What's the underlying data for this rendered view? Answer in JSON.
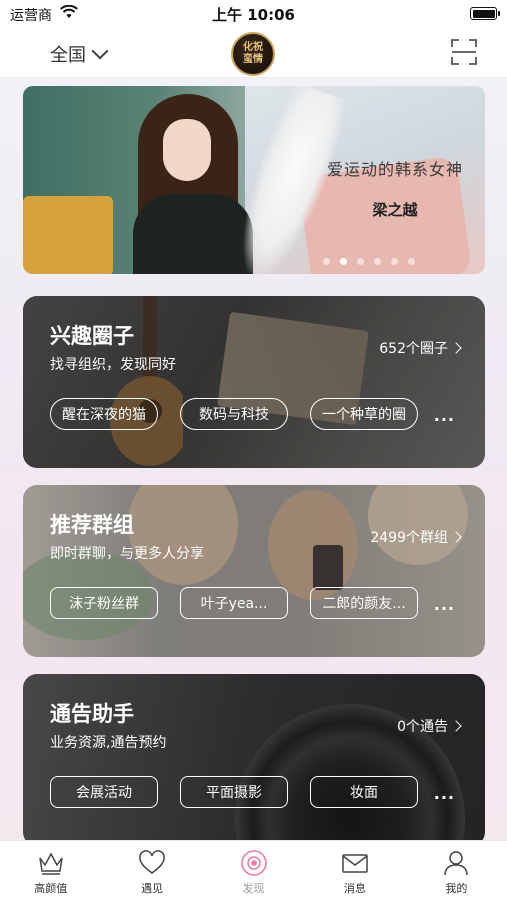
{
  "status_bar": {
    "carrier": "运营商",
    "time": "上午 10:06"
  },
  "nav": {
    "region": "全国",
    "logo_text": [
      "化祝",
      "蛮情"
    ]
  },
  "banner": {
    "title": "爱运动的韩系女神",
    "name": "梁之越",
    "dots": 6,
    "active_dot": 1
  },
  "cards": [
    {
      "title": "兴趣圈子",
      "subtitle": "找寻组织，发现同好",
      "count": "652个圈子",
      "tags": [
        "醒在深夜的猫",
        "数码与科技",
        "一个种草的圈"
      ],
      "more": "..."
    },
    {
      "title": "推荐群组",
      "subtitle": "即时群聊，与更多人分享",
      "count": "2499个群组",
      "tags": [
        "沫子粉丝群",
        "叶子yea...",
        "二郎的颜友..."
      ],
      "more": "..."
    },
    {
      "title": "通告助手",
      "subtitle": "业务资源,通告预约",
      "count": "0个通告",
      "tags": [
        "会展活动",
        "平面摄影",
        "妆面"
      ],
      "more": "..."
    }
  ],
  "tabbar": {
    "items": [
      {
        "label": "高颜值",
        "icon": "crown-icon"
      },
      {
        "label": "遇见",
        "icon": "heart-icon"
      },
      {
        "label": "发现",
        "icon": "discover-icon"
      },
      {
        "label": "消息",
        "icon": "mail-icon"
      },
      {
        "label": "我的",
        "icon": "person-icon"
      }
    ],
    "active_index": 2,
    "active_color": "#f07aa8"
  }
}
